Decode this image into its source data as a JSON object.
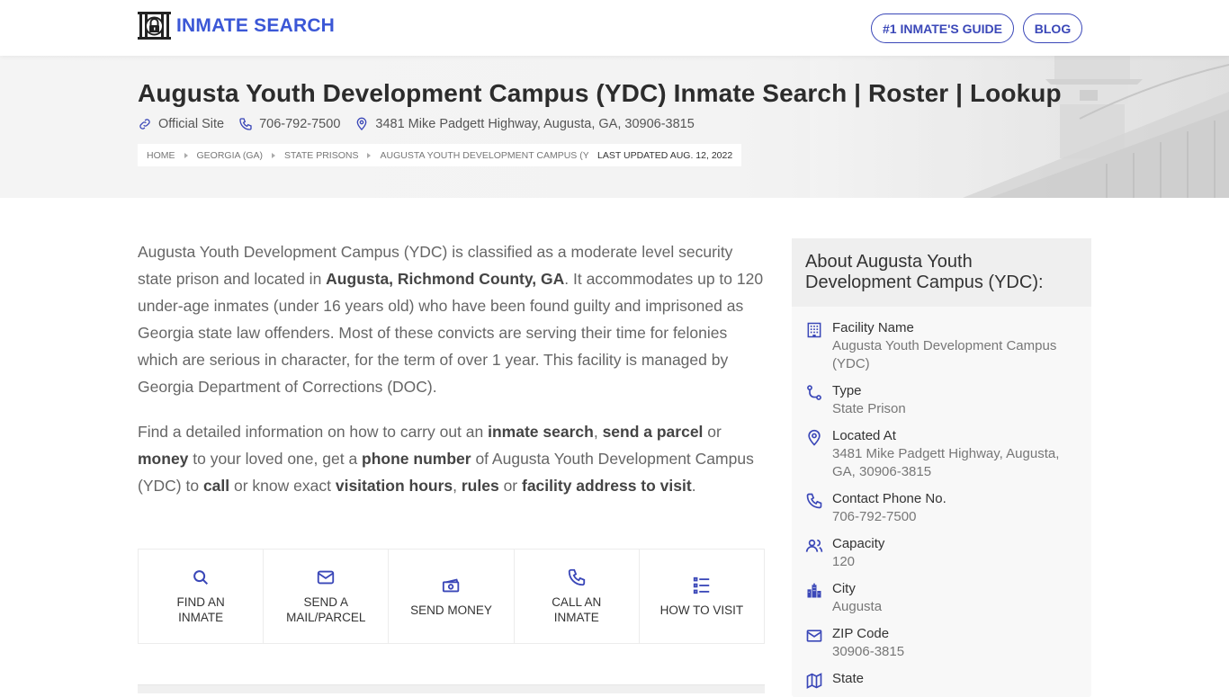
{
  "header": {
    "logo_text": "INMATE SEARCH",
    "logo_icon": "jail-lock-icon",
    "nav": [
      {
        "label": "#1 INMATE'S GUIDE"
      },
      {
        "label": "BLOG"
      }
    ]
  },
  "hero": {
    "title": "Augusta Youth Development Campus (YDC) Inmate Search | Roster | Lookup",
    "official_site": "Official Site",
    "phone": "706-792-7500",
    "address": "3481 Mike Padgett Highway, Augusta, GA, 30906-3815",
    "breadcrumb": [
      "HOME",
      "GEORGIA (GA)",
      "STATE PRISONS",
      "AUGUSTA YOUTH DEVELOPMENT CAMPUS (YDC)"
    ],
    "last_updated": "LAST UPDATED AUG. 12, 2022"
  },
  "intro": {
    "p1": [
      {
        "t": "Augusta Youth Development Campus (YDC) is classified as a moderate level security state prison and located in "
      },
      {
        "t": "Augusta, Richmond County, GA",
        "b": true
      },
      {
        "t": ". It accommodates up to 120 under-age inmates (under 16 years old) who have been found guilty and imprisoned as Georgia state law offenders. Most of these convicts are serving their time for felonies which are serious in character, for the term of over 1 year. This facility is managed by Georgia Department of Corrections (DOC)."
      }
    ],
    "p2": [
      {
        "t": "Find a detailed information on how to carry out an "
      },
      {
        "t": "inmate search",
        "b": true
      },
      {
        "t": ", "
      },
      {
        "t": "send a parcel",
        "b": true
      },
      {
        "t": " or "
      },
      {
        "t": "money",
        "b": true
      },
      {
        "t": " to your loved one, get a "
      },
      {
        "t": "phone number",
        "b": true
      },
      {
        "t": " of Augusta Youth Development Campus (YDC) to "
      },
      {
        "t": "call",
        "b": true
      },
      {
        "t": " or know exact "
      },
      {
        "t": "visitation hours",
        "b": true
      },
      {
        "t": ", "
      },
      {
        "t": "rules",
        "b": true
      },
      {
        "t": " or "
      },
      {
        "t": "facility address to visit",
        "b": true
      },
      {
        "t": "."
      }
    ]
  },
  "actions": [
    {
      "label": "Find an inmate",
      "icon": "search-icon"
    },
    {
      "label": "Send a mail/parcel",
      "icon": "mail-icon"
    },
    {
      "label": "Send money",
      "icon": "money-icon"
    },
    {
      "label": "Call an inmate",
      "icon": "phone-icon"
    },
    {
      "label": "How to visit",
      "icon": "list-icon"
    }
  ],
  "sidebar": {
    "title": "About Augusta Youth Development Campus (YDC):",
    "items": [
      {
        "label": "Facility Name",
        "value": "Augusta Youth Development Campus (YDC)",
        "icon": "building-icon"
      },
      {
        "label": "Type",
        "value": "State Prison",
        "icon": "route-icon"
      },
      {
        "label": "Located At",
        "value": "3481 Mike Padgett Highway, Augusta, GA, 30906-3815",
        "icon": "map-pin-icon"
      },
      {
        "label": "Contact Phone No.",
        "value": "706-792-7500",
        "icon": "phone-icon"
      },
      {
        "label": "Capacity",
        "value": "120",
        "icon": "users-icon"
      },
      {
        "label": "City",
        "value": "Augusta",
        "icon": "city-icon"
      },
      {
        "label": "ZIP Code",
        "value": "30906-3815",
        "icon": "mail-icon"
      },
      {
        "label": "State",
        "value": "",
        "icon": "map-icon"
      }
    ]
  },
  "colors": {
    "brand": "#3b57d6",
    "nav_outline": "#3a47b8",
    "icon": "#3a47b8"
  }
}
